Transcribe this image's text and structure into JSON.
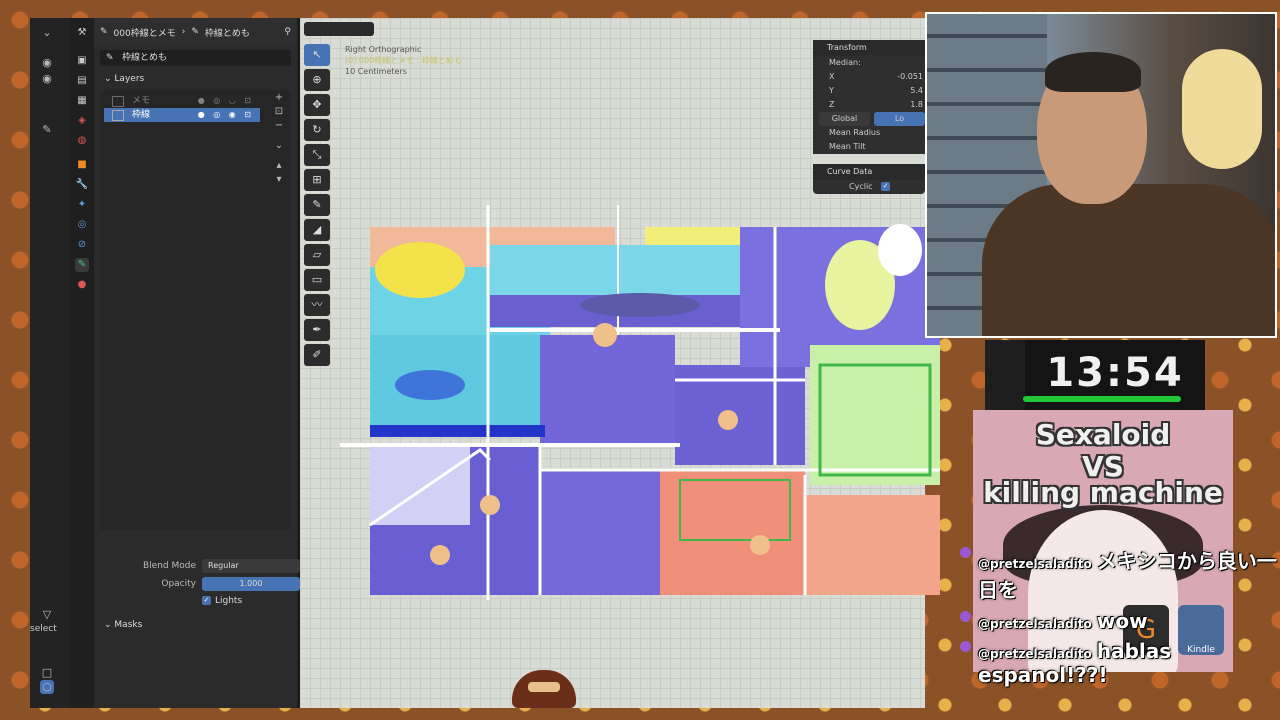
{
  "properties": {
    "breadcrumb_object": "000枠線とメモ",
    "breadcrumb_data": "枠線とめも",
    "data_name": "枠線とめも",
    "layers_panel": "Layers",
    "layers": [
      {
        "name": "メモ",
        "active": false
      },
      {
        "name": "枠線",
        "active": true
      }
    ],
    "blend_mode_label": "Blend Mode",
    "blend_mode_value": "Regular",
    "opacity_label": "Opacity",
    "opacity_value": "1.000",
    "lights_label": "Lights",
    "masks_label": "Masks",
    "left_select_label": "select"
  },
  "viewport": {
    "view_name": "Right Orthographic",
    "object_line": "(0) 000枠線とメモ : 枠線とめも",
    "scale": "10 Centimeters"
  },
  "npanel": {
    "transform_header": "Transform",
    "median_label": "Median:",
    "x_label": "X",
    "x_value": "-0.051",
    "y_label": "Y",
    "y_value": "5.4",
    "z_label": "Z",
    "z_value": "1.8",
    "global_label": "Global",
    "local_label": "Lo",
    "mean_radius_label": "Mean Radius",
    "mean_tilt_label": "Mean Tilt",
    "curve_data_header": "Curve Data",
    "cyclic_label": "Cyclic"
  },
  "timer": {
    "value": "13:54"
  },
  "book": {
    "line1": "Sexaloid",
    "line2": "VS",
    "line3": "killing machine",
    "publisher": "Kindle"
  },
  "chat": [
    {
      "user": "@pretzelsaladito",
      "text": "メキシコから良い一日を"
    },
    {
      "user": "@pretzelsaladito",
      "text": "wow"
    },
    {
      "user": "@pretzelsaladito",
      "text": "hablas espanol!??!"
    }
  ]
}
